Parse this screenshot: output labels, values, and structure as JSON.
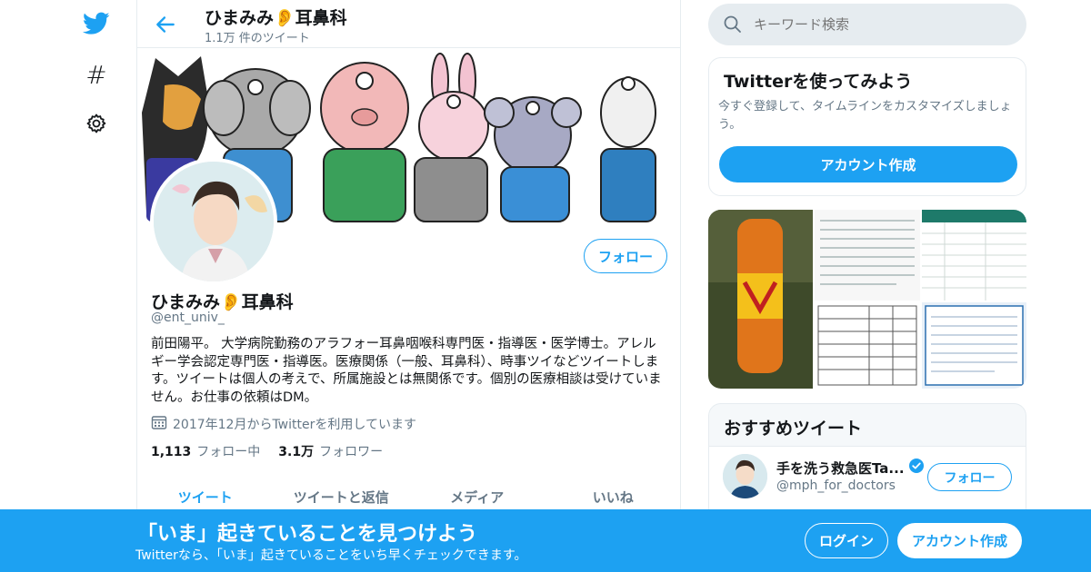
{
  "colors": {
    "accent": "#1da1f2",
    "text": "#14171a",
    "muted": "#657786",
    "border": "#e6ecf0"
  },
  "nav": {
    "icons": [
      "twitter-bird-icon",
      "hashtag-icon",
      "settings-gear-icon"
    ],
    "hash_glyph": "#"
  },
  "header": {
    "name": "ひまみみ👂耳鼻科",
    "tweet_count": "1.1万 件のツイート"
  },
  "profile": {
    "follow_label": "フォロー",
    "name": "ひまみみ👂耳鼻科",
    "handle": "@ent_univ_",
    "bio": "前田陽平。 大学病院勤務のアラフォー耳鼻咽喉科専門医・指導医・医学博士。アレルギー学会認定専門医・指導医。医療関係（一般、耳鼻科）、時事ツイなどツイートします。ツイートは個人の考えで、所属施設とは無関係です。個別の医療相談は受けていません。お仕事の依頼はDM。",
    "joined": "2017年12月からTwitterを利用しています",
    "following_count": "1,113",
    "following_label": "フォロー中",
    "followers_count": "3.1万",
    "followers_label": "フォロワー"
  },
  "tabs": [
    {
      "label": "ツイート",
      "active": true
    },
    {
      "label": "ツイートと返信",
      "active": false
    },
    {
      "label": "メディア",
      "active": false
    },
    {
      "label": "いいね",
      "active": false
    }
  ],
  "search": {
    "placeholder": "キーワード検索"
  },
  "signup_card": {
    "title": "Twitterを使ってみよう",
    "subtitle": "今すぐ登録して、タイムラインをカスタマイズしましょう。",
    "button": "アカウント作成"
  },
  "recommend": {
    "title": "おすすめツイート",
    "item": {
      "name": "手を洗う救急医Ta...",
      "handle": "@mph_for_doctors",
      "verified": true,
      "follow_label": "フォロー"
    }
  },
  "bottom_bar": {
    "title": "「いま」起きていることを見つけよう",
    "subtitle": "Twitterなら、「いま」起きていることをいち早くチェックできます。",
    "login": "ログイン",
    "signup": "アカウント作成"
  }
}
